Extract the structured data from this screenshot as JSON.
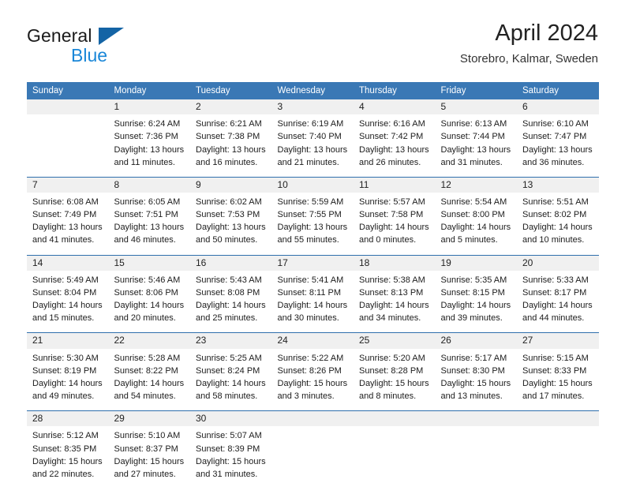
{
  "brand": {
    "name_part1": "General",
    "name_part2": "Blue",
    "logo_icon": "triangle-icon",
    "accent_blue": "#1a87d8",
    "triangle_blue": "#1464a5"
  },
  "header": {
    "title": "April 2024",
    "subtitle": "Storebro, Kalmar, Sweden"
  },
  "theme": {
    "header_row_bg": "#3a78b5",
    "row_divider": "#2f6fad",
    "daynum_bg": "#f0f0f0",
    "text": "#1c1c1c"
  },
  "calendar": {
    "weekday_headers": [
      "Sunday",
      "Monday",
      "Tuesday",
      "Wednesday",
      "Thursday",
      "Friday",
      "Saturday"
    ],
    "weeks": [
      {
        "days": [
          {
            "num": "",
            "lines": []
          },
          {
            "num": "1",
            "lines": [
              "Sunrise: 6:24 AM",
              "Sunset: 7:36 PM",
              "Daylight: 13 hours",
              "and 11 minutes."
            ]
          },
          {
            "num": "2",
            "lines": [
              "Sunrise: 6:21 AM",
              "Sunset: 7:38 PM",
              "Daylight: 13 hours",
              "and 16 minutes."
            ]
          },
          {
            "num": "3",
            "lines": [
              "Sunrise: 6:19 AM",
              "Sunset: 7:40 PM",
              "Daylight: 13 hours",
              "and 21 minutes."
            ]
          },
          {
            "num": "4",
            "lines": [
              "Sunrise: 6:16 AM",
              "Sunset: 7:42 PM",
              "Daylight: 13 hours",
              "and 26 minutes."
            ]
          },
          {
            "num": "5",
            "lines": [
              "Sunrise: 6:13 AM",
              "Sunset: 7:44 PM",
              "Daylight: 13 hours",
              "and 31 minutes."
            ]
          },
          {
            "num": "6",
            "lines": [
              "Sunrise: 6:10 AM",
              "Sunset: 7:47 PM",
              "Daylight: 13 hours",
              "and 36 minutes."
            ]
          }
        ]
      },
      {
        "days": [
          {
            "num": "7",
            "lines": [
              "Sunrise: 6:08 AM",
              "Sunset: 7:49 PM",
              "Daylight: 13 hours",
              "and 41 minutes."
            ]
          },
          {
            "num": "8",
            "lines": [
              "Sunrise: 6:05 AM",
              "Sunset: 7:51 PM",
              "Daylight: 13 hours",
              "and 46 minutes."
            ]
          },
          {
            "num": "9",
            "lines": [
              "Sunrise: 6:02 AM",
              "Sunset: 7:53 PM",
              "Daylight: 13 hours",
              "and 50 minutes."
            ]
          },
          {
            "num": "10",
            "lines": [
              "Sunrise: 5:59 AM",
              "Sunset: 7:55 PM",
              "Daylight: 13 hours",
              "and 55 minutes."
            ]
          },
          {
            "num": "11",
            "lines": [
              "Sunrise: 5:57 AM",
              "Sunset: 7:58 PM",
              "Daylight: 14 hours",
              "and 0 minutes."
            ]
          },
          {
            "num": "12",
            "lines": [
              "Sunrise: 5:54 AM",
              "Sunset: 8:00 PM",
              "Daylight: 14 hours",
              "and 5 minutes."
            ]
          },
          {
            "num": "13",
            "lines": [
              "Sunrise: 5:51 AM",
              "Sunset: 8:02 PM",
              "Daylight: 14 hours",
              "and 10 minutes."
            ]
          }
        ]
      },
      {
        "days": [
          {
            "num": "14",
            "lines": [
              "Sunrise: 5:49 AM",
              "Sunset: 8:04 PM",
              "Daylight: 14 hours",
              "and 15 minutes."
            ]
          },
          {
            "num": "15",
            "lines": [
              "Sunrise: 5:46 AM",
              "Sunset: 8:06 PM",
              "Daylight: 14 hours",
              "and 20 minutes."
            ]
          },
          {
            "num": "16",
            "lines": [
              "Sunrise: 5:43 AM",
              "Sunset: 8:08 PM",
              "Daylight: 14 hours",
              "and 25 minutes."
            ]
          },
          {
            "num": "17",
            "lines": [
              "Sunrise: 5:41 AM",
              "Sunset: 8:11 PM",
              "Daylight: 14 hours",
              "and 30 minutes."
            ]
          },
          {
            "num": "18",
            "lines": [
              "Sunrise: 5:38 AM",
              "Sunset: 8:13 PM",
              "Daylight: 14 hours",
              "and 34 minutes."
            ]
          },
          {
            "num": "19",
            "lines": [
              "Sunrise: 5:35 AM",
              "Sunset: 8:15 PM",
              "Daylight: 14 hours",
              "and 39 minutes."
            ]
          },
          {
            "num": "20",
            "lines": [
              "Sunrise: 5:33 AM",
              "Sunset: 8:17 PM",
              "Daylight: 14 hours",
              "and 44 minutes."
            ]
          }
        ]
      },
      {
        "days": [
          {
            "num": "21",
            "lines": [
              "Sunrise: 5:30 AM",
              "Sunset: 8:19 PM",
              "Daylight: 14 hours",
              "and 49 minutes."
            ]
          },
          {
            "num": "22",
            "lines": [
              "Sunrise: 5:28 AM",
              "Sunset: 8:22 PM",
              "Daylight: 14 hours",
              "and 54 minutes."
            ]
          },
          {
            "num": "23",
            "lines": [
              "Sunrise: 5:25 AM",
              "Sunset: 8:24 PM",
              "Daylight: 14 hours",
              "and 58 minutes."
            ]
          },
          {
            "num": "24",
            "lines": [
              "Sunrise: 5:22 AM",
              "Sunset: 8:26 PM",
              "Daylight: 15 hours",
              "and 3 minutes."
            ]
          },
          {
            "num": "25",
            "lines": [
              "Sunrise: 5:20 AM",
              "Sunset: 8:28 PM",
              "Daylight: 15 hours",
              "and 8 minutes."
            ]
          },
          {
            "num": "26",
            "lines": [
              "Sunrise: 5:17 AM",
              "Sunset: 8:30 PM",
              "Daylight: 15 hours",
              "and 13 minutes."
            ]
          },
          {
            "num": "27",
            "lines": [
              "Sunrise: 5:15 AM",
              "Sunset: 8:33 PM",
              "Daylight: 15 hours",
              "and 17 minutes."
            ]
          }
        ]
      },
      {
        "days": [
          {
            "num": "28",
            "lines": [
              "Sunrise: 5:12 AM",
              "Sunset: 8:35 PM",
              "Daylight: 15 hours",
              "and 22 minutes."
            ]
          },
          {
            "num": "29",
            "lines": [
              "Sunrise: 5:10 AM",
              "Sunset: 8:37 PM",
              "Daylight: 15 hours",
              "and 27 minutes."
            ]
          },
          {
            "num": "30",
            "lines": [
              "Sunrise: 5:07 AM",
              "Sunset: 8:39 PM",
              "Daylight: 15 hours",
              "and 31 minutes."
            ]
          },
          {
            "num": "",
            "lines": []
          },
          {
            "num": "",
            "lines": []
          },
          {
            "num": "",
            "lines": []
          },
          {
            "num": "",
            "lines": []
          }
        ]
      }
    ]
  }
}
